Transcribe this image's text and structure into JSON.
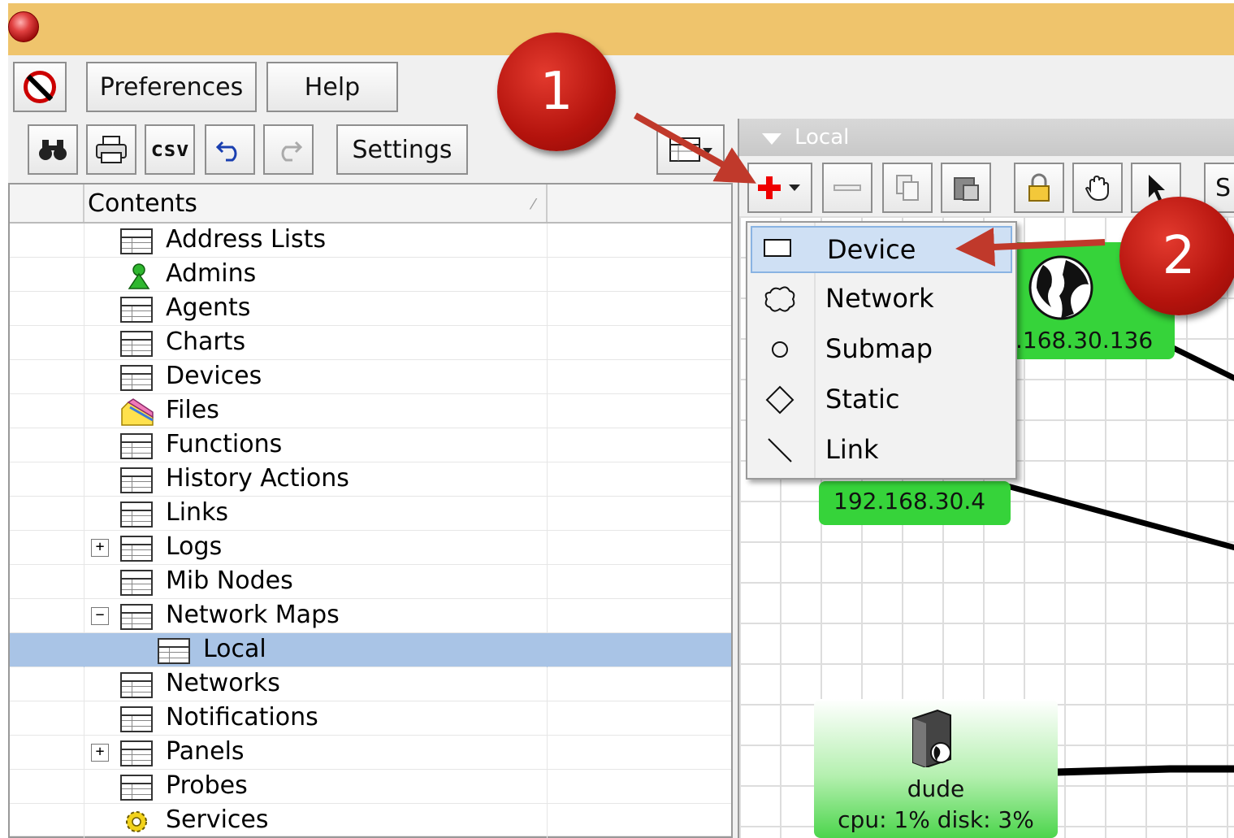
{
  "menubar": {
    "preferences_label": "Preferences",
    "help_label": "Help"
  },
  "toolbar": {
    "csv_label": "csv",
    "settings_label": "Settings"
  },
  "tree": {
    "header_label": "Contents",
    "items": [
      {
        "label": "Address Lists"
      },
      {
        "label": "Admins"
      },
      {
        "label": "Agents"
      },
      {
        "label": "Charts"
      },
      {
        "label": "Devices"
      },
      {
        "label": "Files"
      },
      {
        "label": "Functions"
      },
      {
        "label": "History Actions"
      },
      {
        "label": "Links"
      },
      {
        "label": "Logs"
      },
      {
        "label": "Mib Nodes"
      },
      {
        "label": "Network Maps"
      },
      {
        "label": "Local"
      },
      {
        "label": "Networks"
      },
      {
        "label": "Notifications"
      },
      {
        "label": "Panels"
      },
      {
        "label": "Probes"
      },
      {
        "label": "Services"
      }
    ]
  },
  "map": {
    "tab_label": "Local",
    "toolbar_partial_label": "S",
    "nodes": {
      "node1_label": ".168.30.136",
      "node2_label": "192.168.30.4",
      "dude_name": "dude",
      "dude_stats": "cpu: 1% disk: 3%"
    }
  },
  "add_menu": {
    "items": [
      {
        "label": "Device",
        "icon": "rectangle-icon"
      },
      {
        "label": "Network",
        "icon": "cloud-icon"
      },
      {
        "label": "Submap",
        "icon": "circle-icon"
      },
      {
        "label": "Static",
        "icon": "diamond-icon"
      },
      {
        "label": "Link",
        "icon": "line-icon"
      }
    ]
  },
  "callouts": {
    "first": "1",
    "second": "2"
  },
  "colors": {
    "titlebar": "#efc46c",
    "selection": "#a9c4e6",
    "node_green": "#36d33a",
    "callout_red": "#b4130d"
  }
}
